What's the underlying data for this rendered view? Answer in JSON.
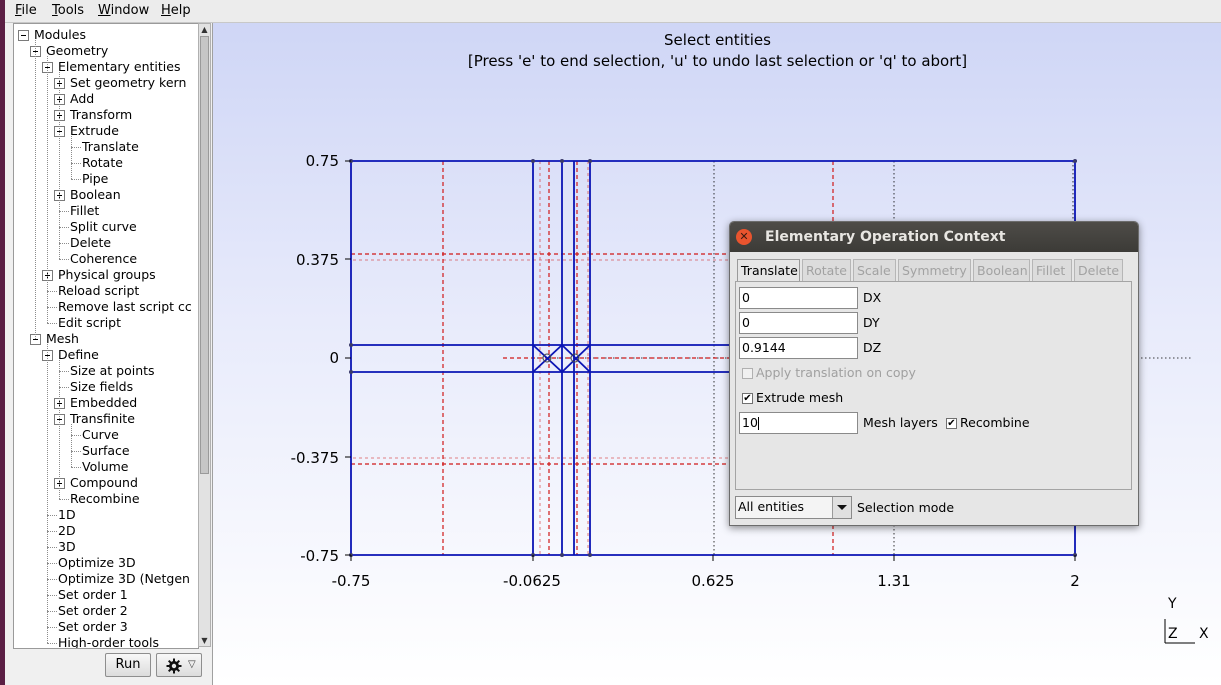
{
  "menubar": {
    "items": [
      {
        "first": "F",
        "rest": "ile"
      },
      {
        "first": "T",
        "rest": "ools"
      },
      {
        "first": "W",
        "rest": "indow"
      },
      {
        "first": "H",
        "rest": "elp"
      }
    ]
  },
  "tree": {
    "items": [
      {
        "label": "Modules",
        "level": 0,
        "toggle": "minus"
      },
      {
        "label": "Geometry",
        "level": 1,
        "toggle": "minus"
      },
      {
        "label": "Elementary entities",
        "level": 2,
        "toggle": "minus"
      },
      {
        "label": "Set geometry kern",
        "level": 3,
        "toggle": "plus"
      },
      {
        "label": "Add",
        "level": 3,
        "toggle": "plus"
      },
      {
        "label": "Transform",
        "level": 3,
        "toggle": "plus"
      },
      {
        "label": "Extrude",
        "level": 3,
        "toggle": "minus"
      },
      {
        "label": "Translate",
        "level": 4,
        "toggle": "none"
      },
      {
        "label": "Rotate",
        "level": 4,
        "toggle": "none"
      },
      {
        "label": "Pipe",
        "level": 4,
        "toggle": "none"
      },
      {
        "label": "Boolean",
        "level": 3,
        "toggle": "plus"
      },
      {
        "label": "Fillet",
        "level": 3,
        "toggle": "none"
      },
      {
        "label": "Split curve",
        "level": 3,
        "toggle": "none"
      },
      {
        "label": "Delete",
        "level": 3,
        "toggle": "none"
      },
      {
        "label": "Coherence",
        "level": 3,
        "toggle": "none"
      },
      {
        "label": "Physical groups",
        "level": 2,
        "toggle": "plus"
      },
      {
        "label": "Reload script",
        "level": 2,
        "toggle": "none"
      },
      {
        "label": "Remove last script cc",
        "level": 2,
        "toggle": "none"
      },
      {
        "label": "Edit script",
        "level": 2,
        "toggle": "none"
      },
      {
        "label": "Mesh",
        "level": 1,
        "toggle": "minus"
      },
      {
        "label": "Define",
        "level": 2,
        "toggle": "minus"
      },
      {
        "label": "Size at points",
        "level": 3,
        "toggle": "none"
      },
      {
        "label": "Size fields",
        "level": 3,
        "toggle": "none"
      },
      {
        "label": "Embedded",
        "level": 3,
        "toggle": "plus"
      },
      {
        "label": "Transfinite",
        "level": 3,
        "toggle": "minus"
      },
      {
        "label": "Curve",
        "level": 4,
        "toggle": "none"
      },
      {
        "label": "Surface",
        "level": 4,
        "toggle": "none"
      },
      {
        "label": "Volume",
        "level": 4,
        "toggle": "none"
      },
      {
        "label": "Compound",
        "level": 3,
        "toggle": "plus"
      },
      {
        "label": "Recombine",
        "level": 3,
        "toggle": "none"
      },
      {
        "label": "1D",
        "level": 2,
        "toggle": "none"
      },
      {
        "label": "2D",
        "level": 2,
        "toggle": "none"
      },
      {
        "label": "3D",
        "level": 2,
        "toggle": "none"
      },
      {
        "label": "Optimize 3D",
        "level": 2,
        "toggle": "none"
      },
      {
        "label": "Optimize 3D (Netgen",
        "level": 2,
        "toggle": "none"
      },
      {
        "label": "Set order 1",
        "level": 2,
        "toggle": "none"
      },
      {
        "label": "Set order 2",
        "level": 2,
        "toggle": "none"
      },
      {
        "label": "Set order 3",
        "level": 2,
        "toggle": "none"
      },
      {
        "label": "High-order tools",
        "level": 2,
        "toggle": "none"
      }
    ]
  },
  "bottom": {
    "run_label": "Run",
    "settings_icon": "gear-icon",
    "dropdown_glyph": "▽"
  },
  "graphics": {
    "message_line1": "Select entities",
    "message_line2": "[Press 'e' to end selection, 'u' to undo last selection or 'q' to abort]",
    "x_ticks": [
      "-0.75",
      "-0.0625",
      "0.625",
      "1.31",
      "2"
    ],
    "y_ticks": [
      "0.75",
      "0.375",
      "0",
      "-0.375",
      "-0.75"
    ],
    "axes_indicator": {
      "y": "Y",
      "z": "Z",
      "x": "X"
    },
    "colors": {
      "geometry": "#0a14b4",
      "mesh_red": "#d01818",
      "guides": "#000000"
    }
  },
  "dialog": {
    "title": "Elementary Operation Context",
    "close_glyph": "✕",
    "tabs": [
      {
        "label": "Translate",
        "active": true
      },
      {
        "label": "Rotate",
        "active": false
      },
      {
        "label": "Scale",
        "active": false
      },
      {
        "label": "Symmetry",
        "active": false
      },
      {
        "label": "Boolean",
        "active": false
      },
      {
        "label": "Fillet",
        "active": false
      },
      {
        "label": "Delete",
        "active": false
      }
    ],
    "dx_value": "0",
    "dx_label": "DX",
    "dy_value": "0",
    "dy_label": "DY",
    "dz_value": "0.9144",
    "dz_label": "DZ",
    "apply_on_copy_label": "Apply translation on copy",
    "apply_on_copy_checked": false,
    "extrude_mesh_label": "Extrude mesh",
    "extrude_mesh_checked": true,
    "mesh_layers_value": "10",
    "mesh_layers_label": "Mesh layers",
    "recombine_label": "Recombine",
    "recombine_checked": true,
    "selection_value": "All entities",
    "selection_label": "Selection mode",
    "check_glyph": "✔"
  }
}
